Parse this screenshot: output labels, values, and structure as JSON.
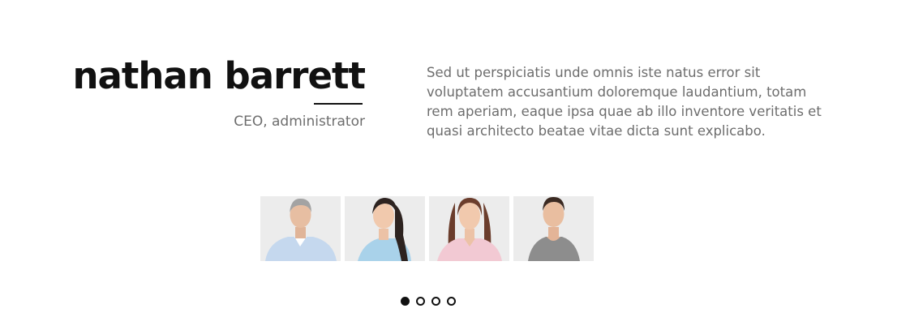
{
  "testimonial": {
    "name": "nathan barrett",
    "role": "CEO, administrator",
    "bio": "Sed ut perspiciatis unde omnis iste natus error sit voluptatem accusantium doloremque laudantium, totam rem aperiam, eaque ipsa quae ab illo inventore veritatis et quasi architecto beatae vitae dicta sunt explicabo."
  },
  "thumbnails": [
    {
      "icon": "person-photo",
      "shirt_color": "#c5d8ee"
    },
    {
      "icon": "person-photo",
      "shirt_color": "#a9d2ea"
    },
    {
      "icon": "person-photo",
      "shirt_color": "#f2c9d3"
    },
    {
      "icon": "person-photo",
      "shirt_color": "#8d8d8d"
    }
  ],
  "pagination": {
    "total": 4,
    "active_index": 0
  },
  "colors": {
    "heading": "#111111",
    "body_text": "#6d6d6d",
    "thumb_background": "#ececec"
  }
}
